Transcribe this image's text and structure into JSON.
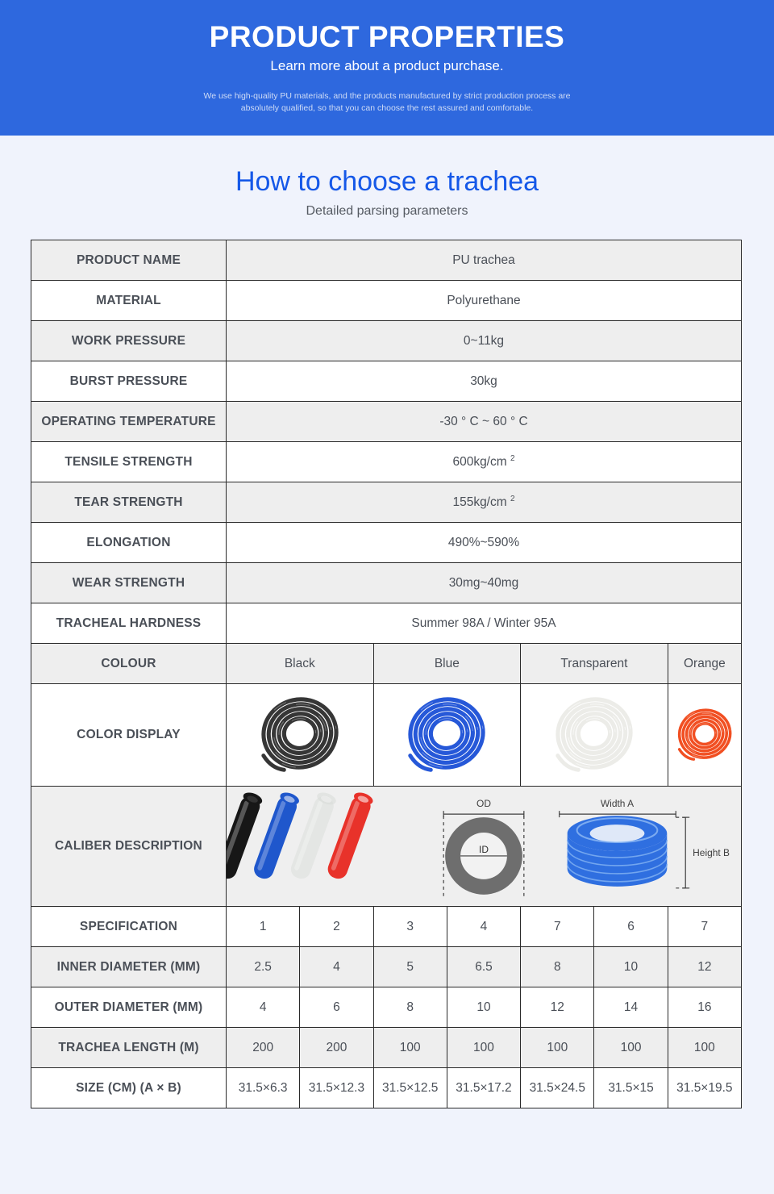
{
  "hero": {
    "title": "PRODUCT PROPERTIES",
    "subtitle": "Learn more about a product purchase.",
    "description": "We use high-quality PU materials, and the products manufactured by strict production process are absolutely qualified, so that you can choose the rest assured and comfortable.",
    "bg_color": "#2e68de"
  },
  "section": {
    "title": "How to choose a trachea",
    "subtitle": "Detailed parsing parameters",
    "title_color": "#1558e8"
  },
  "table": {
    "properties": [
      {
        "label": "PRODUCT NAME",
        "value": "PU trachea"
      },
      {
        "label": "MATERIAL",
        "value": "Polyurethane"
      },
      {
        "label": "WORK PRESSURE",
        "value": "0~11kg"
      },
      {
        "label": "BURST PRESSURE",
        "value": "30kg"
      },
      {
        "label": "OPERATING TEMPERATURE",
        "value": "-30 ° C ~ 60 ° C"
      },
      {
        "label": "TENSILE STRENGTH",
        "value": "600kg/cm",
        "sup": "2"
      },
      {
        "label": "TEAR STRENGTH",
        "value": "155kg/cm",
        "sup": "2"
      },
      {
        "label": "ELONGATION",
        "value": "490%~590%"
      },
      {
        "label": "WEAR STRENGTH",
        "value": "30mg~40mg"
      },
      {
        "label": "TRACHEAL HARDNESS",
        "value": "Summer 98A / Winter 95A"
      }
    ],
    "colour_row": {
      "label": "COLOUR",
      "options": [
        "Black",
        "Blue",
        "Transparent",
        "Orange"
      ]
    },
    "color_display_row": {
      "label": "COLOR DISPLAY",
      "swatch_colors": [
        "#2b2b2b",
        "#1a4fd6",
        "#dcdcd6",
        "#f04616"
      ]
    },
    "caliber_row": {
      "label": "CALIBER DESCRIPTION",
      "diagram_labels": {
        "od": "OD",
        "id": "ID",
        "width": "Width A",
        "height": "Height B"
      },
      "tube_colors": [
        "#171717",
        "#1f57cc",
        "#d8dcd8",
        "#e8322a"
      ]
    },
    "measurements": [
      {
        "label": "SPECIFICATION",
        "values": [
          "1",
          "2",
          "3",
          "4",
          "7",
          "6",
          "7"
        ]
      },
      {
        "label": "INNER DIAMETER (MM)",
        "values": [
          "2.5",
          "4",
          "5",
          "6.5",
          "8",
          "10",
          "12"
        ]
      },
      {
        "label": "OUTER DIAMETER (MM)",
        "values": [
          "4",
          "6",
          "8",
          "10",
          "12",
          "14",
          "16"
        ]
      },
      {
        "label": "TRACHEA LENGTH (M)",
        "values": [
          "200",
          "200",
          "100",
          "100",
          "100",
          "100",
          "100"
        ]
      },
      {
        "label": "SIZE (CM) (A × B)",
        "values": [
          "31.5×6.3",
          "31.5×12.3",
          "31.5×12.5",
          "31.5×17.2",
          "31.5×24.5",
          "31.5×15",
          "31.5×19.5"
        ]
      }
    ]
  }
}
